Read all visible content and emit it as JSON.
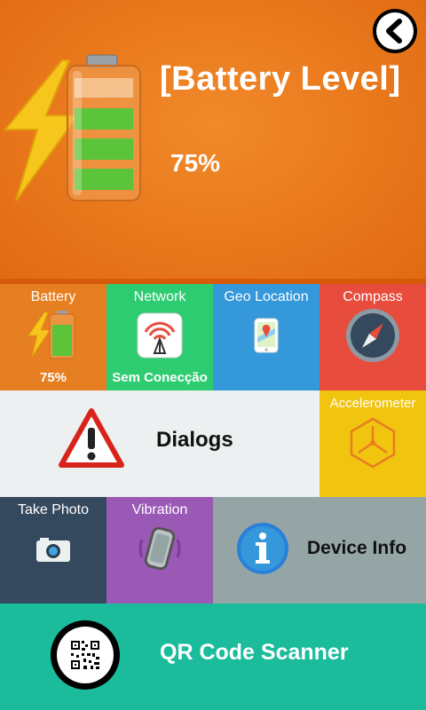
{
  "header": {
    "title": "[Battery Level]",
    "percent": "75%",
    "back_icon": "chevron-left-icon",
    "battery_icon": "battery-charging-icon"
  },
  "tiles": {
    "battery": {
      "label": "Battery",
      "value": "75%",
      "level": 0.75,
      "color": "#e67e22"
    },
    "network": {
      "label": "Network",
      "status": "Sem Conecção",
      "color": "#2ecc71"
    },
    "geo": {
      "label": "Geo Location",
      "color": "#3498db"
    },
    "compass": {
      "label": "Compass",
      "color": "#e74c3c"
    },
    "dialogs": {
      "label": "Dialogs",
      "color": "#ecf0f1"
    },
    "accelerometer": {
      "label": "Accelerometer",
      "color": "#f1c40f"
    },
    "take_photo": {
      "label": "Take Photo",
      "color": "#34495e"
    },
    "vibration": {
      "label": "Vibration",
      "color": "#9b59b6"
    },
    "device_info": {
      "label": "Device Info",
      "color": "#95a5a6"
    },
    "qr": {
      "label": "QR Code Scanner",
      "color": "#1abc9c"
    }
  },
  "colors": {
    "hero": "#e9781c",
    "hero_border": "#d65a0a"
  }
}
